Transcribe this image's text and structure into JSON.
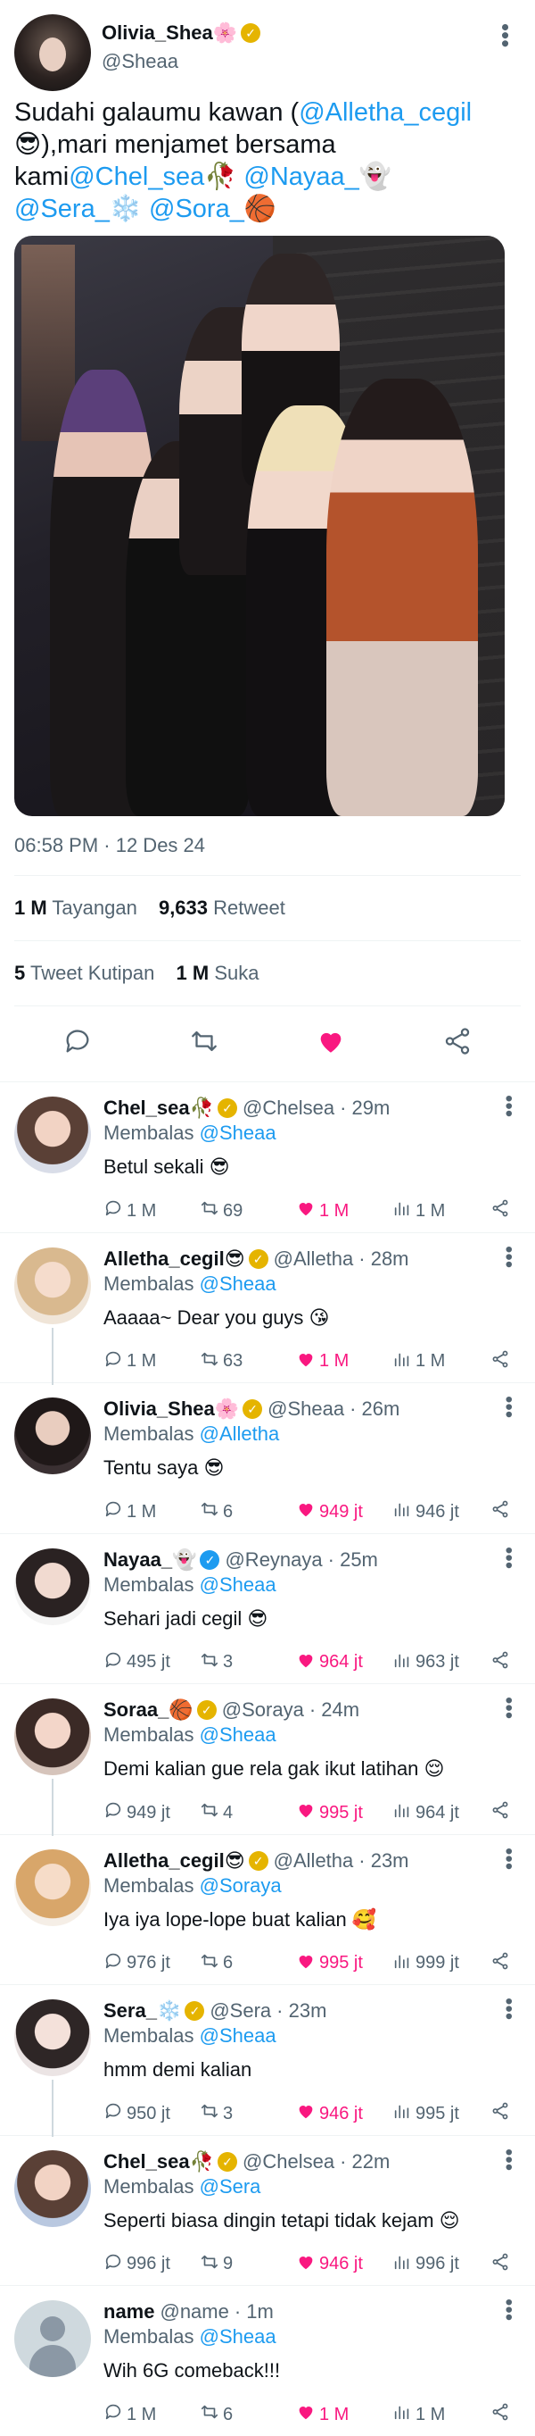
{
  "main_tweet": {
    "display_name": "Olivia_Shea🌸",
    "handle": "@Sheaa",
    "text_parts": {
      "t1": "Sudahi galaumu kawan (",
      "m1": "@Alletha_cegil",
      "t2": " 😎),mari menjamet bersama kami",
      "m2": "@Chel_sea",
      "t3": "🥀 ",
      "m3": "@Nayaa_",
      "t4": "👻 ",
      "m4": "@Sera_",
      "t5": "❄️ ",
      "m5": "@Sora_",
      "t6": "🏀"
    },
    "timestamp": "06:58 PM · 12 Des 24",
    "views_count": "1 M",
    "views_label": "Tayangan",
    "retweets_count": "9,633",
    "retweets_label": "Retweet",
    "quotes_count": "5",
    "quotes_label": "Tweet Kutipan",
    "likes_count": "1 M",
    "likes_label": "Suka"
  },
  "icons": {
    "reply": "reply-icon",
    "retweet": "retweet-icon",
    "like": "heart-icon",
    "share": "share-icon",
    "views": "views-icon",
    "more": "more-icon"
  },
  "colors": {
    "accent": "#1d9bf0",
    "like": "#f91880",
    "muted": "#536471",
    "verified_gold": "#e5b400"
  },
  "replying_prefix": "Membalas",
  "replies": [
    {
      "name": "Chel_sea🥀",
      "badge": "gold",
      "handle": "@Chelsea",
      "time": "· 29m",
      "to": "@Sheaa",
      "text": "Betul sekali 😎",
      "replies": "1 M",
      "retweets": "69",
      "likes": "1 M",
      "views": "1 M",
      "thread": false
    },
    {
      "name": "Alletha_cegil😎",
      "badge": "gold",
      "handle": "@Alletha",
      "time": "· 28m",
      "to": "@Sheaa",
      "text": "Aaaaa~ Dear you guys 😘",
      "replies": "1 M",
      "retweets": "63",
      "likes": "1 M",
      "views": "1 M",
      "thread": true
    },
    {
      "name": "Olivia_Shea🌸",
      "badge": "gold",
      "handle": "@Sheaa",
      "time": "· 26m",
      "to": "@Alletha",
      "text": "Tentu saya 😎",
      "replies": "1 M",
      "retweets": "6",
      "likes": "949 jt",
      "views": "946 jt",
      "thread": false
    },
    {
      "name": "Nayaa_👻",
      "badge": "blue",
      "handle": "@Reynaya",
      "time": "· 25m",
      "to": "@Sheaa",
      "text": "Sehari jadi cegil 😎",
      "replies": "495 jt",
      "retweets": "3",
      "likes": "964 jt",
      "views": "963 jt",
      "thread": false
    },
    {
      "name": "Soraa_🏀",
      "badge": "gold",
      "handle": "@Soraya",
      "time": "· 24m",
      "to": "@Sheaa",
      "text": "Demi kalian gue rela gak ikut latihan 😌",
      "replies": "949 jt",
      "retweets": "4",
      "likes": "995 jt",
      "views": "964 jt",
      "thread": true
    },
    {
      "name": "Alletha_cegil😎",
      "badge": "gold",
      "handle": "@Alletha",
      "time": "· 23m",
      "to": "@Soraya",
      "text": "Iya iya lope-lope buat kalian 🥰",
      "replies": "976 jt",
      "retweets": "6",
      "likes": "995 jt",
      "views": "999 jt",
      "thread": false
    },
    {
      "name": "Sera_❄️",
      "badge": "gold",
      "handle": "@Sera",
      "time": "· 23m",
      "to": "@Sheaa",
      "text": "hmm demi kalian",
      "replies": "950 jt",
      "retweets": "3",
      "likes": "946 jt",
      "views": "995 jt",
      "thread": true
    },
    {
      "name": "Chel_sea🥀",
      "badge": "gold",
      "handle": "@Chelsea",
      "time": "· 22m",
      "to": "@Sera",
      "text": "Seperti biasa dingin tetapi tidak kejam 😌",
      "replies": "996 jt",
      "retweets": "9",
      "likes": "946 jt",
      "views": "996 jt",
      "thread": false
    },
    {
      "name": "name",
      "badge": "none",
      "handle": "@name",
      "time": "· 1m",
      "to": "@Sheaa",
      "text": "Wih 6G comeback!!!",
      "replies": "1 M",
      "retweets": "6",
      "likes": "1 M",
      "views": "1 M",
      "thread": false
    }
  ]
}
